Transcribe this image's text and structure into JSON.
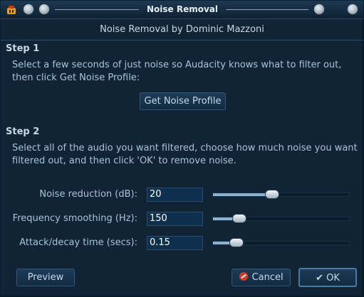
{
  "window": {
    "title": "Noise Removal"
  },
  "credit": "Noise Removal by Dominic Mazzoni",
  "step1": {
    "heading": "Step 1",
    "line1": "Select a few seconds of just noise so Audacity knows what to filter out,",
    "line2": "then click Get Noise Profile:",
    "button": "Get Noise Profile"
  },
  "step2": {
    "heading": "Step 2",
    "line1": "Select all of the audio you want filtered, choose how much noise you want",
    "line2": "filtered out, and then click 'OK' to remove noise."
  },
  "params": [
    {
      "label": "Noise reduction (dB):",
      "value": "20",
      "slider_fraction": 0.43
    },
    {
      "label": "Frequency smoothing (Hz):",
      "value": "150",
      "slider_fraction": 0.19
    },
    {
      "label": "Attack/decay time (secs):",
      "value": "0.15",
      "slider_fraction": 0.17
    }
  ],
  "buttons": {
    "preview": "Preview",
    "cancel": "Cancel",
    "ok": "OK"
  },
  "colors": {
    "accent": "#8fb1d0",
    "background": "#102436"
  },
  "icons": {
    "app": "audacity-icon",
    "cancel": "cancel-icon",
    "ok": "checkmark-icon"
  }
}
